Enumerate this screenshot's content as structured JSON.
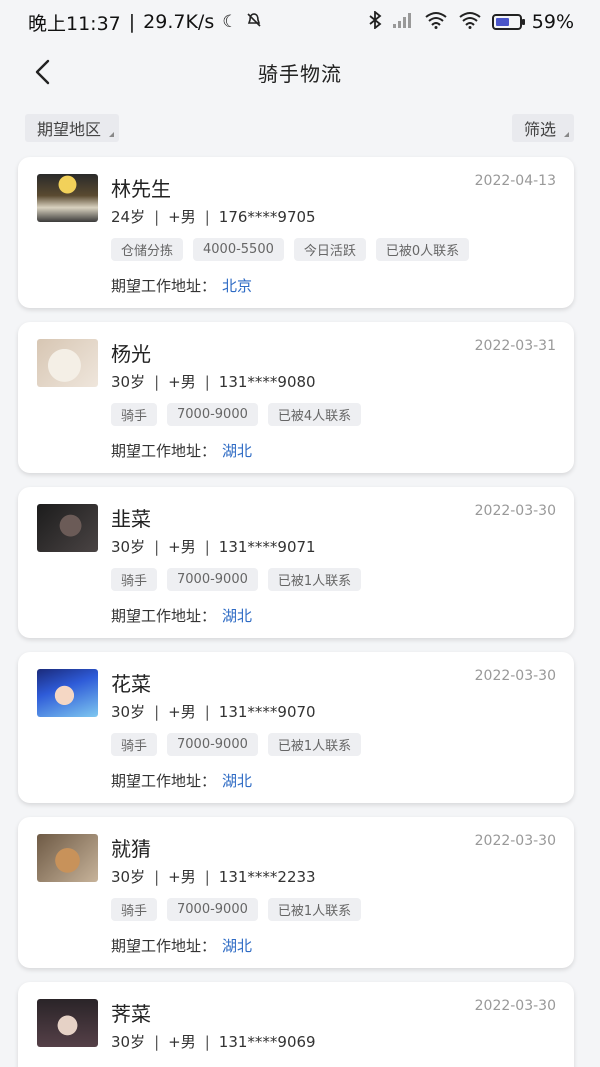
{
  "status_bar": {
    "time": "晚上11:37",
    "speed": "29.7K/s",
    "battery": "59%",
    "battery_fraction": 0.59
  },
  "nav": {
    "title": "骑手物流"
  },
  "filters": {
    "region_label": "期望地区",
    "screen_label": "筛选"
  },
  "address_label": "期望工作地址：",
  "candidates": [
    {
      "name": "林先生",
      "date": "2022-04-13",
      "age": "24岁",
      "gender": "+男",
      "phone": "176****9705",
      "tags": [
        "仓储分拣",
        "4000-5500",
        "今日活跃",
        "已被0人联系"
      ],
      "city": "北京"
    },
    {
      "name": "杨光",
      "date": "2022-03-31",
      "age": "30岁",
      "gender": "+男",
      "phone": "131****9080",
      "tags": [
        "骑手",
        "7000-9000",
        "已被4人联系"
      ],
      "city": "湖北"
    },
    {
      "name": "韭菜",
      "date": "2022-03-30",
      "age": "30岁",
      "gender": "+男",
      "phone": "131****9071",
      "tags": [
        "骑手",
        "7000-9000",
        "已被1人联系"
      ],
      "city": "湖北"
    },
    {
      "name": "花菜",
      "date": "2022-03-30",
      "age": "30岁",
      "gender": "+男",
      "phone": "131****9070",
      "tags": [
        "骑手",
        "7000-9000",
        "已被1人联系"
      ],
      "city": "湖北"
    },
    {
      "name": "就猜",
      "date": "2022-03-30",
      "age": "30岁",
      "gender": "+男",
      "phone": "131****2233",
      "tags": [
        "骑手",
        "7000-9000",
        "已被1人联系"
      ],
      "city": "湖北"
    },
    {
      "name": "荠菜",
      "date": "2022-03-30",
      "age": "30岁",
      "gender": "+男",
      "phone": "131****9069"
    }
  ]
}
